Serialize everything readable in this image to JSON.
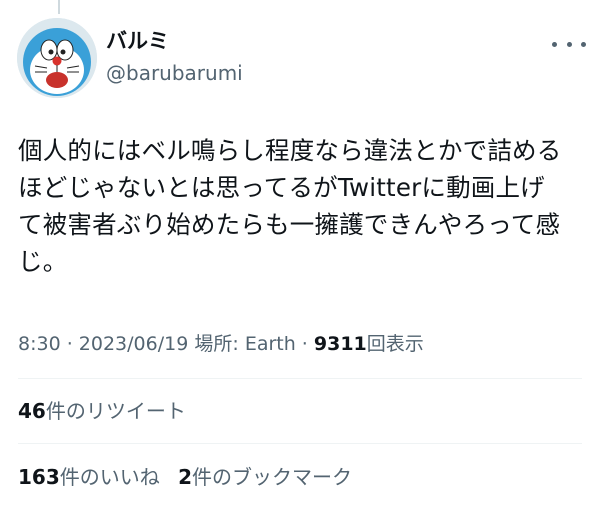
{
  "author": {
    "display_name": "バルミ",
    "handle": "@barubarumi"
  },
  "tweet": {
    "lines": [
      "個人的にはベル鳴らし程度なら違法とかで詰める",
      "ほどじゃないとは思ってるがTwitterに動画上げ",
      "て被害者ぶり始めたらも一擁護できんやろって感",
      "じ。"
    ]
  },
  "meta": {
    "time": "8:30",
    "separator": " · ",
    "date": "2023/06/19",
    "location_label": "場所:",
    "location": "Earth",
    "separator2": " · ",
    "views_count": "9311",
    "views_label": "回表示"
  },
  "stats": {
    "retweets_count": "46",
    "retweets_label": "件のリツイート",
    "likes_count": "163",
    "likes_label": "件のいいね",
    "bookmarks_count": "2",
    "bookmarks_label": "件のブックマーク"
  },
  "icons": {
    "avatar": "doraemon-avatar",
    "more": "more-options-icon"
  },
  "colors": {
    "text": "#0f1419",
    "secondary": "#536471",
    "divider": "#eff3f4"
  }
}
